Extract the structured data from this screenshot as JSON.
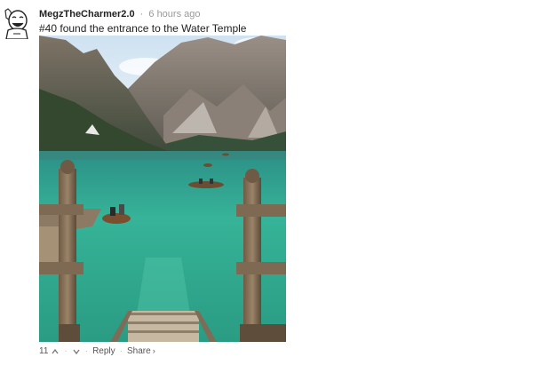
{
  "comment": {
    "username": "MegzTheCharmer2.0",
    "separator": "·",
    "timestamp": "6 hours ago",
    "text": "#40 found the entrance to the Water Temple"
  },
  "actions": {
    "upvote_count": "11",
    "reply_label": "Reply",
    "share_label": "Share",
    "dot": "·"
  },
  "icons": {
    "avatar": "avatar-meme-face",
    "upvote": "chevron-up-icon",
    "downvote": "chevron-down-icon",
    "share": "chevron-right-icon"
  },
  "colors": {
    "username": "#222222",
    "meta": "#999999",
    "water": "#2fa38f",
    "link": "#555555"
  }
}
